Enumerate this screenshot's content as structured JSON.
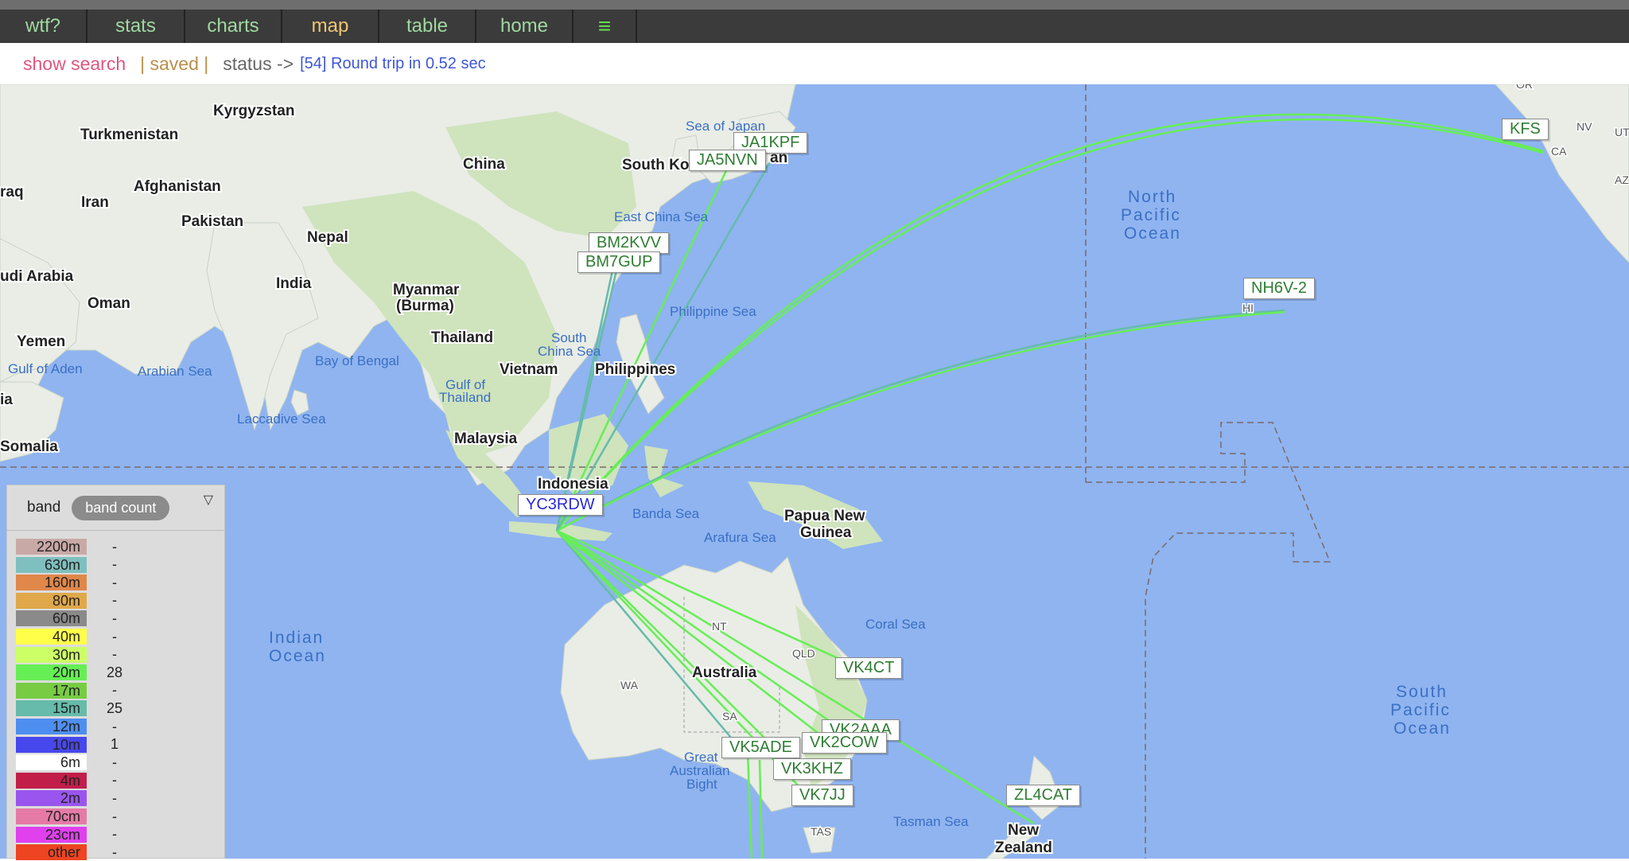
{
  "nav": {
    "items": [
      "wtf?",
      "stats",
      "charts",
      "map",
      "table",
      "home"
    ],
    "menu_icon": "≡"
  },
  "status": {
    "show_search": "show search",
    "saved": "| saved |",
    "label": "status ->",
    "text": "[54] Round trip in 0.52 sec"
  },
  "map": {
    "countries": [
      "Kyrgyzstan",
      "Turkmenistan",
      "China",
      "Afghanistan",
      "Iran",
      "Pakistan",
      "Nepal",
      "udi Arabia",
      "India",
      "Oman",
      "Myanmar",
      "(Burma)",
      "Yemen",
      "Thailand",
      "Vietnam",
      "Philippines",
      "Malaysia",
      "Indonesia",
      "Papua New",
      "Guinea",
      "Australia",
      "New",
      "Zealand",
      "Somalia",
      "raq",
      "ia",
      "South Ko",
      "an"
    ],
    "seas": [
      "Sea of Japan",
      "East China Sea",
      "Philippine Sea",
      "South",
      "China Sea",
      "Bay of Bengal",
      "Arabian Sea",
      "Gulf of Aden",
      "Gulf of",
      "Thailand",
      "Laccadive Sea",
      "Banda Sea",
      "Arafura Sea",
      "Coral Sea",
      "Great",
      "Australian",
      "Bight",
      "Tasman Sea"
    ],
    "oceans": {
      "north_pacific": [
        "North",
        "Pacific",
        "Ocean"
      ],
      "south_pacific": [
        "South",
        "Pacific",
        "Ocean"
      ],
      "indian": [
        "Indian",
        "Ocean"
      ]
    },
    "states": [
      "NT",
      "QLD",
      "WA",
      "SA",
      "TAS",
      "OR",
      "NV",
      "UT",
      "CA",
      "AZ",
      "HI"
    ],
    "callsigns": {
      "home": "YC3RDW",
      "others": [
        "JA1KPF",
        "JA5NVN",
        "BM2KVV",
        "BM7GUP",
        "NH6V-2",
        "KFS",
        "VK4CT",
        "VK2AAA",
        "VK2COW",
        "VK5ADE",
        "VK3KHZ",
        "VK7JJ",
        "ZL4CAT"
      ]
    }
  },
  "legend": {
    "band_label": "band",
    "count_label": "band count",
    "toggle": "▽",
    "rows": [
      {
        "band": "2200m",
        "count": "-",
        "color": "#c9a9a6"
      },
      {
        "band": "630m",
        "count": "-",
        "color": "#7fbfbf"
      },
      {
        "band": "160m",
        "count": "-",
        "color": "#e0874a"
      },
      {
        "band": "80m",
        "count": "-",
        "color": "#e0a84a"
      },
      {
        "band": "60m",
        "count": "-",
        "color": "#8a8a8a"
      },
      {
        "band": "40m",
        "count": "-",
        "color": "#ffff4a"
      },
      {
        "band": "30m",
        "count": "-",
        "color": "#ccff66"
      },
      {
        "band": "20m",
        "count": "28",
        "color": "#66ee55"
      },
      {
        "band": "17m",
        "count": "-",
        "color": "#77cc44"
      },
      {
        "band": "15m",
        "count": "25",
        "color": "#66bbaa"
      },
      {
        "band": "12m",
        "count": "-",
        "color": "#4d8ef0"
      },
      {
        "band": "10m",
        "count": "1",
        "color": "#4747ee"
      },
      {
        "band": "6m",
        "count": "-",
        "color": "#ffffff"
      },
      {
        "band": "4m",
        "count": "-",
        "color": "#c21e4a"
      },
      {
        "band": "2m",
        "count": "-",
        "color": "#9a55ee"
      },
      {
        "band": "70cm",
        "count": "-",
        "color": "#e57aa6"
      },
      {
        "band": "23cm",
        "count": "-",
        "color": "#e040ee"
      },
      {
        "band": "other",
        "count": "-",
        "color": "#ee4422"
      }
    ]
  }
}
